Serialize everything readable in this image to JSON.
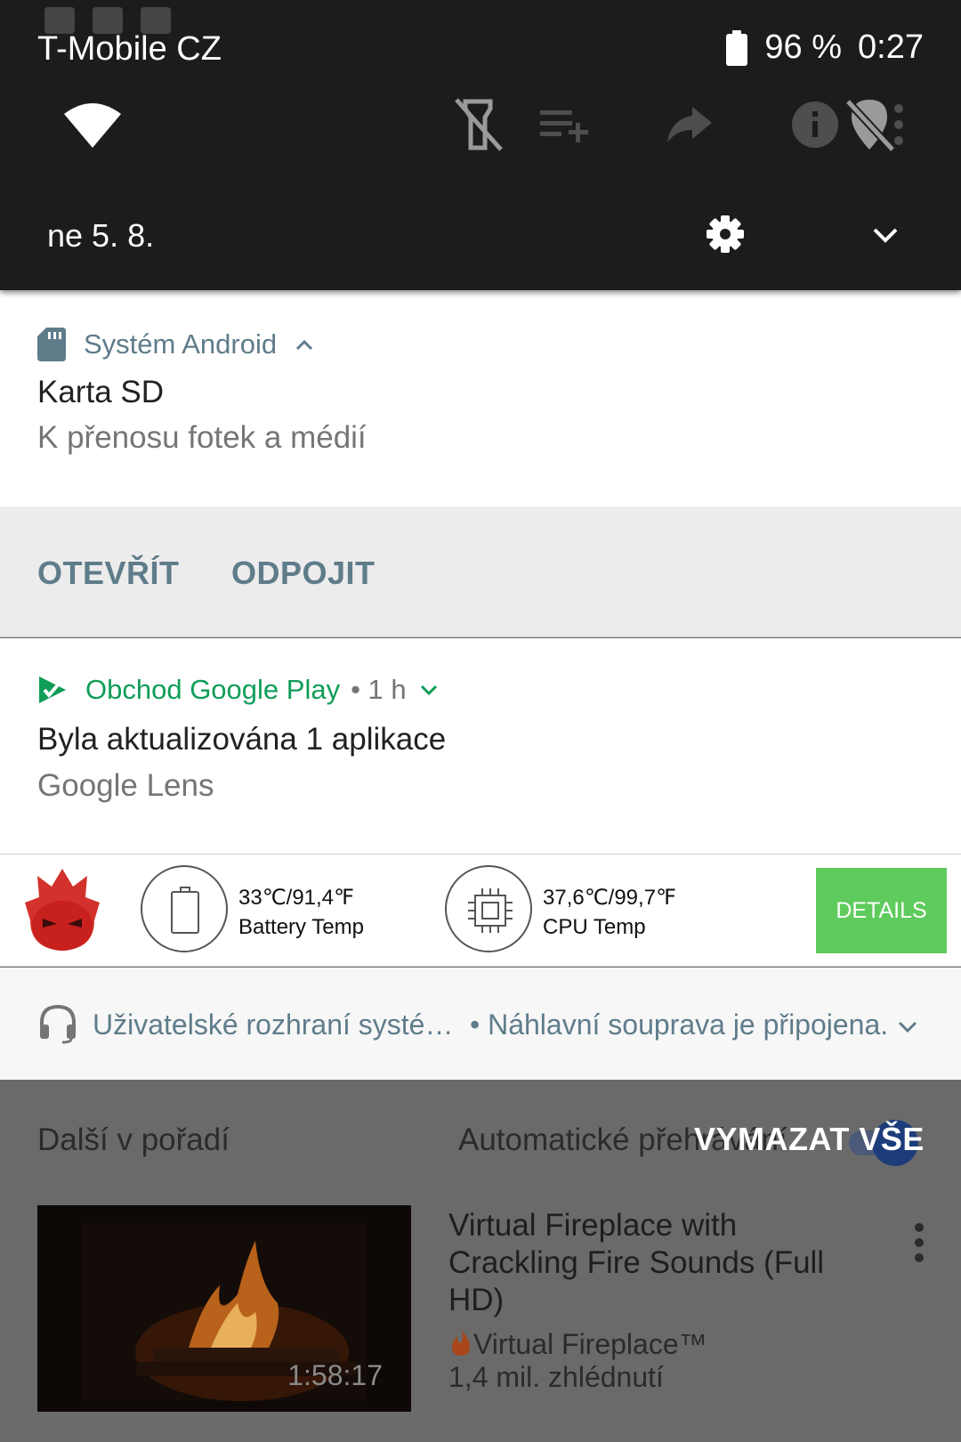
{
  "status_bar": {
    "carrier": "T-Mobile CZ",
    "battery": "96 %",
    "time": "0:27"
  },
  "quick_settings": {
    "date": "ne 5. 8.",
    "icons": [
      "wifi-icon",
      "flashlight-off-icon",
      "playlist-add-icon",
      "share-icon",
      "info-icon",
      "location-off-icon",
      "more-vert-icon"
    ]
  },
  "notifications": {
    "sd_card": {
      "app": "Systém Android",
      "title": "Karta SD",
      "text": "K přenosu fotek a médií",
      "actions": [
        "OTEVŘÍT",
        "ODPOJIT"
      ]
    },
    "play_store": {
      "app": "Obchod Google Play",
      "time": "• 1 h",
      "title": "Byla aktualizována 1 aplikace",
      "text": "Google Lens"
    },
    "antutu": {
      "battery_value": "33℃/91,4℉",
      "battery_label": "Battery Temp",
      "cpu_value": "37,6℃/99,7℉",
      "cpu_label": "CPU Temp",
      "details": "DETAILS"
    },
    "system_ui": {
      "app": "Uživatelské rozhraní systé…",
      "text": "• Náhlavní souprava je připojena."
    },
    "clear_all": "VYMAZAT VŠE"
  },
  "youtube": {
    "up_next": "Další v pořadí",
    "autoplay": "Automatické přehrávání",
    "video": {
      "title": "Virtual Fireplace with Crackling Fire Sounds (Full HD)",
      "channel": "Virtual Fireplace™",
      "views": "1,4 mil. zhlédnutí",
      "duration": "1:58:17"
    }
  },
  "colors": {
    "accent_blue_grey": "#5f7c8a",
    "play_green": "#0f9d58",
    "details_green": "#5fcb5d"
  }
}
